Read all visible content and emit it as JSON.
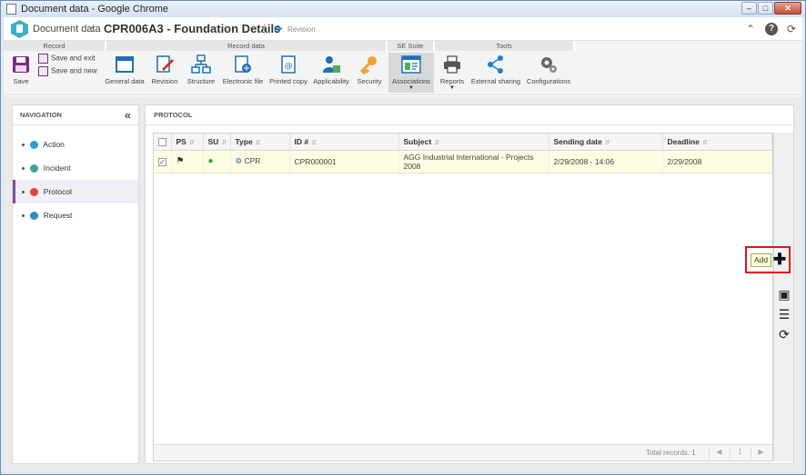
{
  "window": {
    "title": "Document data - Google Chrome"
  },
  "header": {
    "breadcrumb": "Document data",
    "separator": "|",
    "title": "CPR006A3 - Foundation Details",
    "revision_label": "Revision"
  },
  "ribbon": {
    "groups": {
      "record": "Record",
      "record_data": "Record data",
      "se_suite": "SE Suite",
      "tools": "Tools"
    },
    "save": "Save",
    "save_and_exit": "Save and exit",
    "save_and_new": "Save and new",
    "general_data": "General data",
    "revision": "Revision",
    "structure": "Structure",
    "electronic_file": "Electronic file",
    "printed_copy": "Printed copy",
    "applicability": "Applicability",
    "security": "Security",
    "associations": "Associations",
    "reports": "Reports",
    "external_sharing": "External sharing",
    "configurations": "Configurations"
  },
  "navigation": {
    "header": "NAVIGATION",
    "items": [
      {
        "label": "Action",
        "color": "#2a9fd6"
      },
      {
        "label": "Incident",
        "color": "#3aa8a0"
      },
      {
        "label": "Protocol",
        "color": "#e0443a"
      },
      {
        "label": "Request",
        "color": "#2a8fb8"
      }
    ]
  },
  "panel": {
    "header": "PROTOCOL",
    "columns": [
      "PS",
      "SU",
      "Type",
      "ID #",
      "Subject",
      "Sending date",
      "Deadline"
    ],
    "rows": [
      {
        "type": "CPR",
        "id": "CPR000001",
        "subject": "AGG Industrial International - Projects 2008",
        "sending_date": "2/29/2008 - 14:06",
        "deadline": "2/29/2008",
        "checked": true
      }
    ],
    "total_records": "Total records: 1",
    "page": "1"
  },
  "tooltip": {
    "add": "Add"
  },
  "colors": {
    "highlight": "#e8101a",
    "selected_row": "#fdfde1",
    "accent": "#7a4f98"
  }
}
